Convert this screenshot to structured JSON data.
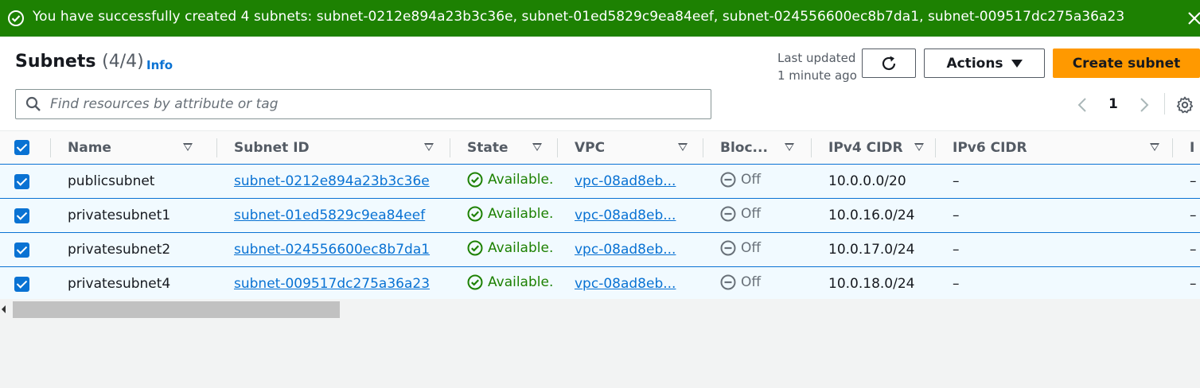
{
  "banner": {
    "message": "You have successfully created 4 subnets: subnet-0212e894a23b3c36e, subnet-01ed5829c9ea84eef, subnet-024556600ec8b7da1, subnet-009517dc275a36a23",
    "color": "#1d8102"
  },
  "header": {
    "title": "Subnets",
    "count": "(4/4)",
    "info": "Info",
    "last_updated_line1": "Last updated",
    "last_updated_line2": "1 minute ago",
    "actions_label": "Actions",
    "create_label": "Create subnet"
  },
  "search": {
    "placeholder": "Find resources by attribute or tag"
  },
  "pagination": {
    "current_page": "1"
  },
  "table": {
    "columns": [
      "Name",
      "Subnet ID",
      "State",
      "VPC",
      "Bloc...",
      "IPv4 CIDR",
      "IPv6 CIDR",
      "I"
    ],
    "rows": [
      {
        "name": "publicsubnet",
        "subnet_id": "subnet-0212e894a23b3c36e",
        "state": "Available.",
        "vpc": "vpc-08ad8eb...",
        "block": "Off",
        "ipv4": "10.0.0.0/20",
        "ipv6": "–",
        "extra": "–"
      },
      {
        "name": "privatesubnet1",
        "subnet_id": "subnet-01ed5829c9ea84eef",
        "state": "Available.",
        "vpc": "vpc-08ad8eb...",
        "block": "Off",
        "ipv4": "10.0.16.0/24",
        "ipv6": "–",
        "extra": "–"
      },
      {
        "name": "privatesubnet2",
        "subnet_id": "subnet-024556600ec8b7da1",
        "state": "Available.",
        "vpc": "vpc-08ad8eb...",
        "block": "Off",
        "ipv4": "10.0.17.0/24",
        "ipv6": "–",
        "extra": "–"
      },
      {
        "name": "privatesubnet4",
        "subnet_id": "subnet-009517dc275a36a23",
        "state": "Available.",
        "vpc": "vpc-08ad8eb...",
        "block": "Off",
        "ipv4": "10.0.18.0/24",
        "ipv6": "–",
        "extra": "–"
      }
    ]
  },
  "colors": {
    "primary_button": "#ff9900",
    "link": "#0972d3",
    "success": "#1d8102"
  }
}
